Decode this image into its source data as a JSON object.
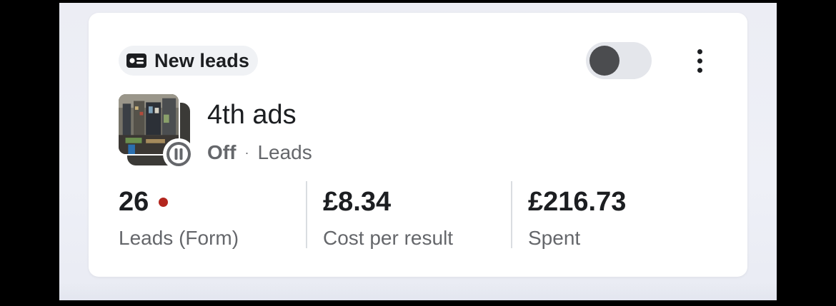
{
  "card": {
    "chip": {
      "icon": "lead-card-icon",
      "label": "New leads"
    },
    "toggle": {
      "state": "off"
    },
    "more_icon": "more-vertical-icon",
    "ad": {
      "name": "4th ads",
      "status": "Off",
      "separator": "·",
      "objective": "Leads",
      "badge_icon": "pause-icon"
    },
    "metrics": [
      {
        "value": "26",
        "label": "Leads (Form)",
        "indicator_color": "#b3261e"
      },
      {
        "value": "£8.34",
        "label": "Cost per result"
      },
      {
        "value": "£216.73",
        "label": "Spent"
      }
    ]
  }
}
